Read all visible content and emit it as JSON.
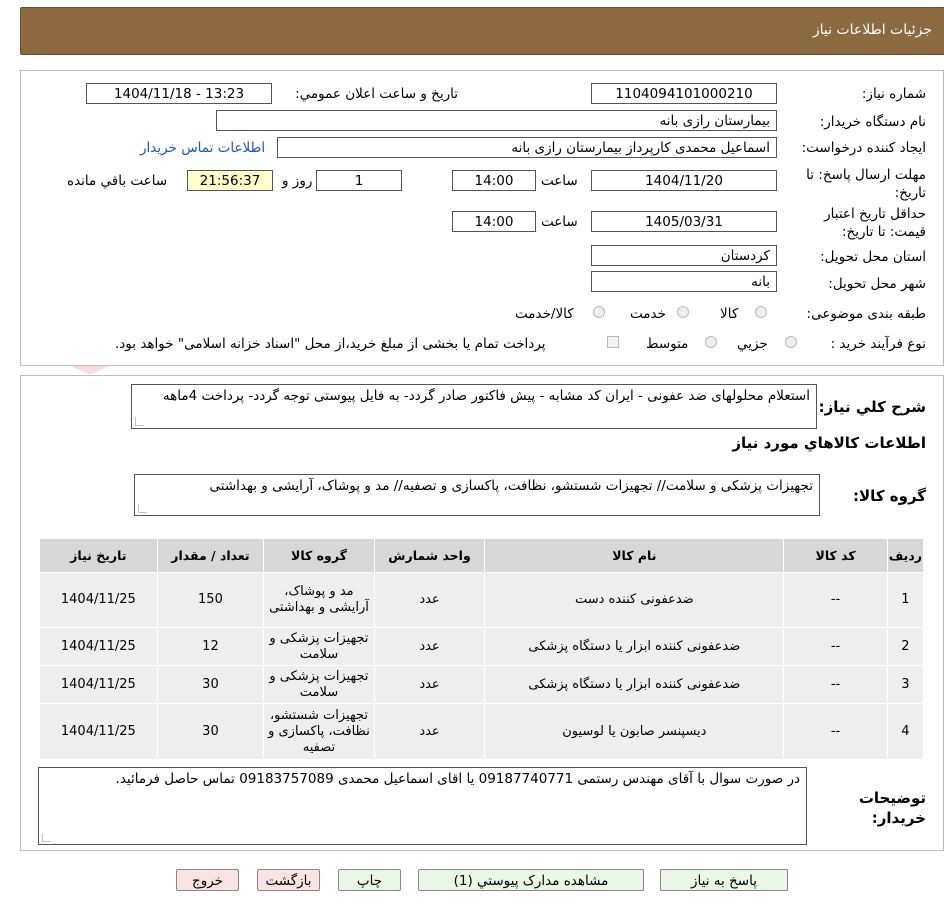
{
  "header": {
    "title": "جزئیات اطلاعات نیاز"
  },
  "watermark": {
    "text": "AriaTender.neT"
  },
  "fields": {
    "need_number_label": "شماره نیاز:",
    "need_number": "1104094101000210",
    "announce_label": "تاریخ و ساعت اعلان عمومي:",
    "announce_value": "1404/11/18 - 13:23",
    "buyer_org_label": "نام دستگاه خریدار:",
    "buyer_org": "بیمارستان رازی بانه",
    "requester_label": "ایجاد کننده درخواست:",
    "requester": "اسماعیل محمدی کارپرداز بیمارستان رازی بانه",
    "contact_link": "اطلاعات تماس خریدار",
    "reply_deadline_label": "مهلت ارسال پاسخ: تا تاریخ:",
    "reply_date": "1404/11/20",
    "time_label": "ساعت",
    "reply_time": "14:00",
    "days": "1",
    "days_label": "روز و",
    "remaining_time": "21:56:37",
    "remaining_label": "ساعت باقي مانده",
    "price_validity_label": "حداقل تاریخ اعتبار قیمت: تا تاریخ:",
    "validity_date": "1405/03/31",
    "validity_time": "14:00",
    "province_label": "استان محل تحویل:",
    "province": "کردستان",
    "city_label": "شهر محل تحویل:",
    "city": "بانه",
    "category_label": "طبقه بندی موضوعی:",
    "category_options": [
      "کالا",
      "خدمت",
      "کالا/خدمت"
    ],
    "process_label": "نوع فرآیند خرید :",
    "process_options": [
      "جزیي",
      "متوسط"
    ],
    "payment_note": "پرداخت تمام یا بخشی از مبلغ خرید،از محل \"اسناد خزانه اسلامی\" خواهد بود."
  },
  "summary": {
    "label": "شرح کلي نیاز:",
    "text": "استعلام محلولهای ضد عفونی - ایران کد مشابه - پیش فاکتور صادر گردد- به فایل پیوستی توجه گردد- پرداخت 4ماهه"
  },
  "goods": {
    "title": "اطلاعات کالاهاي مورد نیاز",
    "group_label": "گروه کالا:",
    "group_text": "تجهیزات پزشکی و سلامت// تجهیزات شستشو، نظافت، پاکسازی و تصفیه// مد و پوشاک، آرایشی و بهداشتی"
  },
  "table": {
    "headers": [
      "ردیف",
      "کد کالا",
      "نام کالا",
      "واحد شمارش",
      "گروه کالا",
      "تعداد / مقدار",
      "تاریخ نیاز"
    ],
    "rows": [
      {
        "row": "1",
        "code": "--",
        "name": "ضدعفونی کننده دست",
        "unit": "عدد",
        "group": "مد و پوشاک، آرایشی و بهداشتی",
        "qty": "150",
        "date": "1404/11/25"
      },
      {
        "row": "2",
        "code": "--",
        "name": "ضدعفونی کننده ابزار یا دستگاه پزشکی",
        "unit": "عدد",
        "group": "تجهیزات پزشکی و سلامت",
        "qty": "12",
        "date": "1404/11/25"
      },
      {
        "row": "3",
        "code": "--",
        "name": "ضدعفونی کننده ابزار یا دستگاه پزشکی",
        "unit": "عدد",
        "group": "تجهیزات پزشکی و سلامت",
        "qty": "30",
        "date": "1404/11/25"
      },
      {
        "row": "4",
        "code": "--",
        "name": "دیسپنسر صابون یا لوسیون",
        "unit": "عدد",
        "group": "تجهیزات شستشو، نظافت، پاکسازی و تصفیه",
        "qty": "30",
        "date": "1404/11/25"
      }
    ]
  },
  "notes": {
    "label": "توضیحات خریدار:",
    "text": "در صورت سوال با آقای مهندس رستمی 09187740771 یا اقای اسماعیل محمدی 09183757089 تماس حاصل فرمائید."
  },
  "buttons": {
    "reply": "پاسخ به نیاز",
    "attachments": "مشاهده مدارک پیوستي (1)",
    "print": "چاپ",
    "back": "بازگشت",
    "exit": "خروج"
  },
  "colors": {
    "header_bg": "#8c6a3f",
    "table_header": "#d7d7d7",
    "table_row": "#eeeeee",
    "timer_bg": "#ffffcc",
    "link": "#1a55c5"
  }
}
